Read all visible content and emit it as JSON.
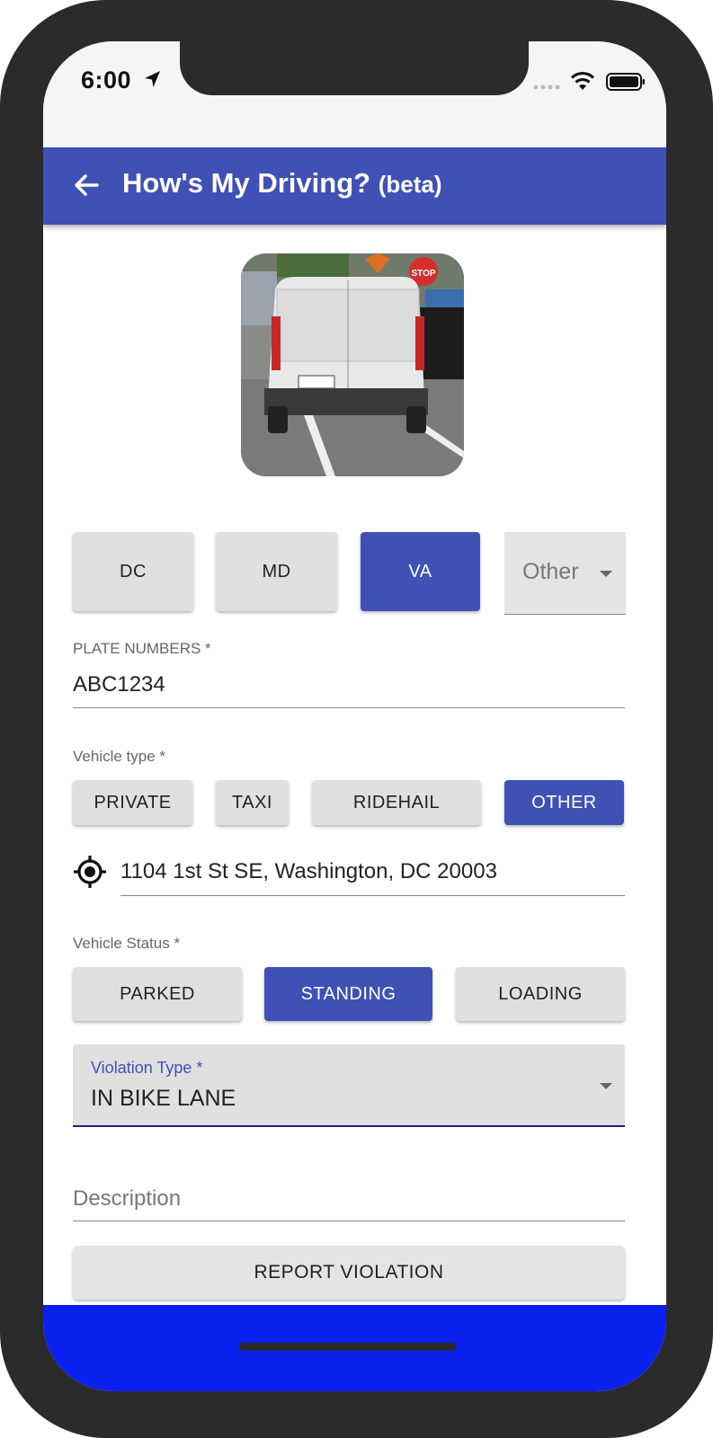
{
  "status_bar": {
    "time": "6:00",
    "icons": [
      "location-arrow-icon",
      "signal-dots-icon",
      "wifi-icon",
      "battery-icon"
    ]
  },
  "app_bar": {
    "title": "How's My Driving?",
    "title_suffix": "(beta)",
    "back_icon": "back-arrow-icon",
    "color": "#3f51b5"
  },
  "photo": {
    "description_icon": "vehicle-photo"
  },
  "state_buttons": [
    {
      "label": "DC",
      "selected": false
    },
    {
      "label": "MD",
      "selected": false
    },
    {
      "label": "VA",
      "selected": true
    }
  ],
  "state_other": {
    "value": "Other"
  },
  "plate": {
    "label": "PLATE NUMBERS *",
    "value": "ABC1234"
  },
  "vehicle_type": {
    "label": "Vehicle type *",
    "options": [
      {
        "label": "PRIVATE",
        "selected": false
      },
      {
        "label": "TAXI",
        "selected": false
      },
      {
        "label": "RIDEHAIL",
        "selected": false
      },
      {
        "label": "OTHER",
        "selected": true
      }
    ]
  },
  "location": {
    "value": "1104 1st St SE, Washington, DC 20003",
    "icon": "gps-target-icon"
  },
  "vehicle_status": {
    "label": "Vehicle Status *",
    "options": [
      {
        "label": "PARKED",
        "selected": false
      },
      {
        "label": "STANDING",
        "selected": true
      },
      {
        "label": "LOADING",
        "selected": false
      }
    ]
  },
  "violation_type": {
    "label": "Violation Type *",
    "value": "IN BIKE LANE"
  },
  "description": {
    "placeholder": "Description"
  },
  "report_button": {
    "label": "REPORT VIOLATION"
  },
  "colors": {
    "primary": "#3f51b5",
    "bottom_bar": "#0a20ee"
  }
}
